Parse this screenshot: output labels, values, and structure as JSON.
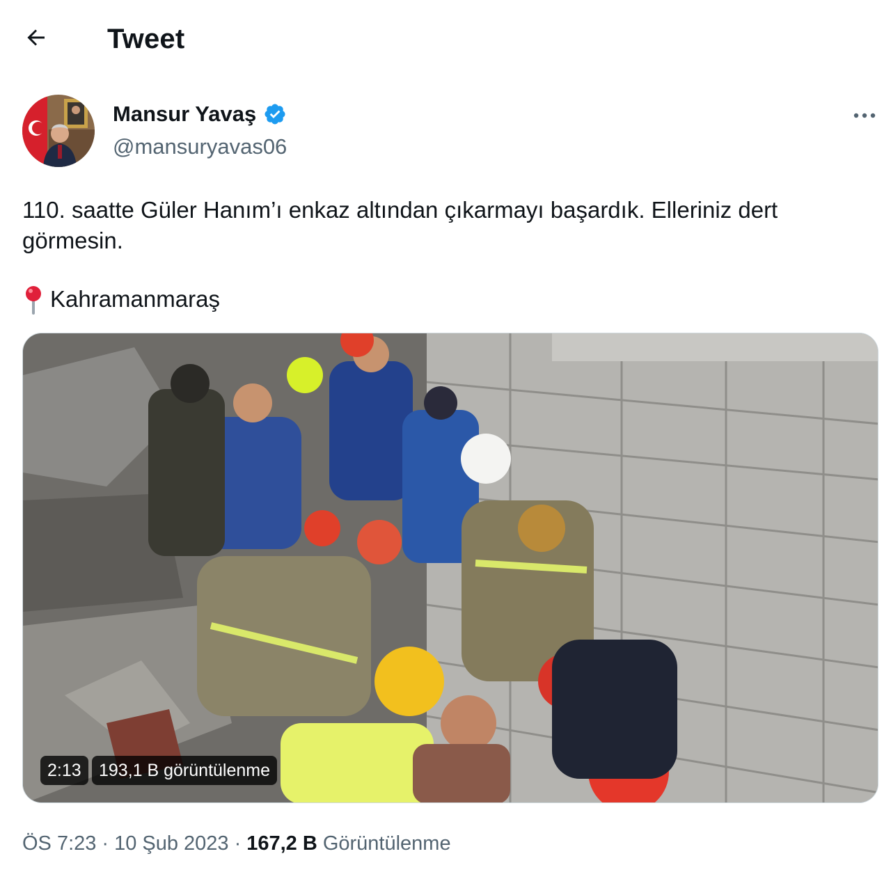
{
  "header": {
    "title": "Tweet",
    "back_icon": "arrow-left-icon"
  },
  "author": {
    "display_name": "Mansur Yavaş",
    "handle": "@mansuryavas06",
    "verified": true,
    "verified_color": "#1d9bf0"
  },
  "tweet": {
    "text": "110. saatte Güler Hanım’ı enkaz altından çıkarmayı başardık. Elleriniz dert görmesin.",
    "location_icon": "pin-icon",
    "location": "Kahramanmaraş"
  },
  "media": {
    "type": "video",
    "duration": "2:13",
    "views": "193,1 B görüntülenme"
  },
  "meta": {
    "time": "ÖS 7:23",
    "date": "10 Şub 2023",
    "separator": "·",
    "views_count": "167,2 B",
    "views_label": "Görüntülenme"
  },
  "colors": {
    "text": "#0f1419",
    "secondary": "#536471",
    "accent": "#1d9bf0"
  }
}
